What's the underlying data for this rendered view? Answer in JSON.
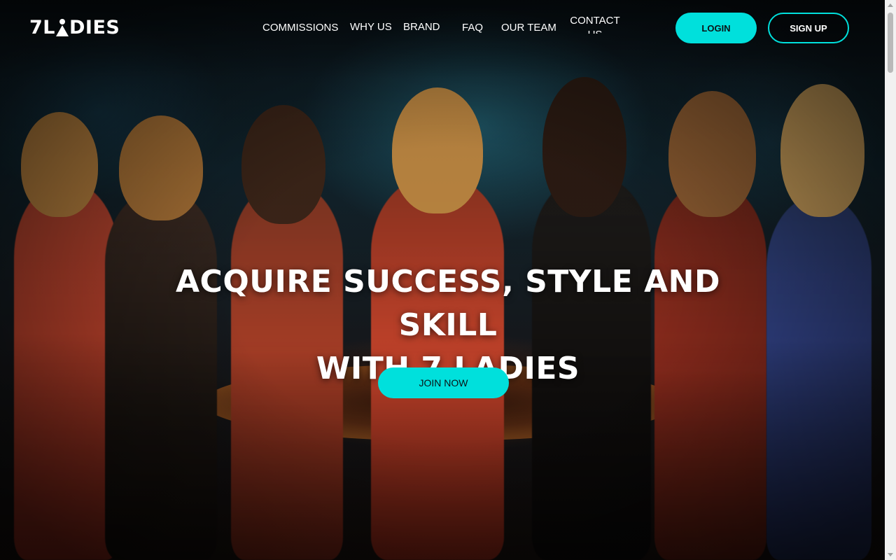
{
  "brand": {
    "logo_prefix": "7L",
    "logo_suffix": "DIES",
    "logo_alt": "7LADIES"
  },
  "nav": {
    "items": [
      {
        "label": "COMMISSIONS"
      },
      {
        "label": "WHY US"
      },
      {
        "label": "BRANDS"
      },
      {
        "label": "FAQ"
      },
      {
        "label": "OUR TEAM"
      },
      {
        "label": "CONTACT US"
      }
    ]
  },
  "header": {
    "login_label": "LOGIN",
    "signup_label": "SIGN UP"
  },
  "hero": {
    "headline_line1": "ACQUIRE SUCCESS, STYLE AND SKILL",
    "headline_line2": "WITH 7 LADIES",
    "cta_label": "JOIN NOW"
  },
  "colors": {
    "accent": "#00e0dc",
    "text": "#ffffff",
    "background": "#0b0f14"
  },
  "icons": {
    "logo_mark": "pawn-icon"
  }
}
